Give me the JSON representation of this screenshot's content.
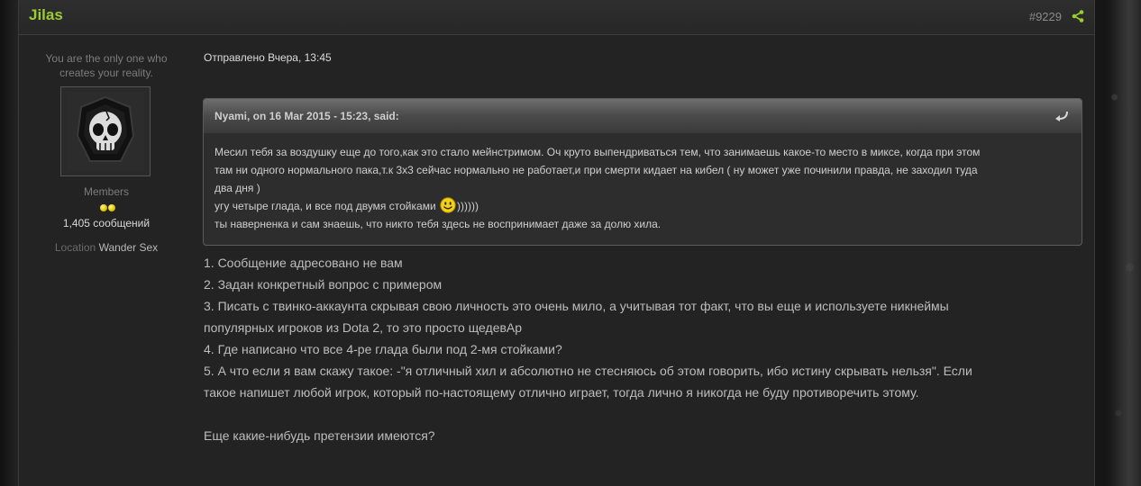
{
  "post": {
    "author": "Jilas",
    "post_number": "#9229",
    "author_title": "You are the only one who creates your reality.",
    "member_group": "Members",
    "posts_count": "1,405 сообщений",
    "location_label": "Location",
    "location_value": "Wander Sex",
    "posted_date": "Отправлено Вчера, 13:45"
  },
  "quote": {
    "citation": "Nyami, on 16 Mar 2015 - 15:23, said:",
    "line1": "Месил тебя за воздушку еще до того,как это стало мейнстримом. Оч круто выпендриваться тем, что занимаешь какое-то место в миксе, когда при этом",
    "line2": "там ни одного нормального пака,т.к 3х3 сейчас нормально не работает,и при смерти кидает на кибел ( ну может уже починили правда, не заходил туда",
    "line3": "два дня )",
    "line4_before": "угу четыре глада, и все под двумя стойками",
    "line4_after": "))))))",
    "line5": "ты наверненка и сам знаешь, что никто тебя здесь не воспринимает даже за долю хила."
  },
  "body": {
    "line1": "1. Сообщение адресовано не вам",
    "line2": "2. Задан конкретный вопрос с примером",
    "line3": "3. Писать с твинко-аккаунта скрывая свою личность это очень мило, а учитывая тот факт, что вы еще и используете никнеймы",
    "line4": "популярных игроков из Dota 2, то это просто щедевАр",
    "line5": "4. Где написано что все 4-ре глада были под 2-мя стойками?",
    "line6": "5. А что если я вам скажу такое: -\"я отличный хил и абсолютно не стесняюсь об этом говорить, ибо истину скрывать нельзя\". Если",
    "line7": "такое напишет любой игрок, который по-настоящему отлично играет, тогда лично я никогда не буду противоречить этому.",
    "line8": "Еще какие-нибудь претензии имеются?"
  },
  "colors": {
    "accent": "#9acd32",
    "background": "#232323"
  },
  "icons": {
    "share": "share-icon",
    "avatar": "skull-icon",
    "quote_jump": "arrow-return-icon",
    "smiley": "smiley-icon"
  }
}
